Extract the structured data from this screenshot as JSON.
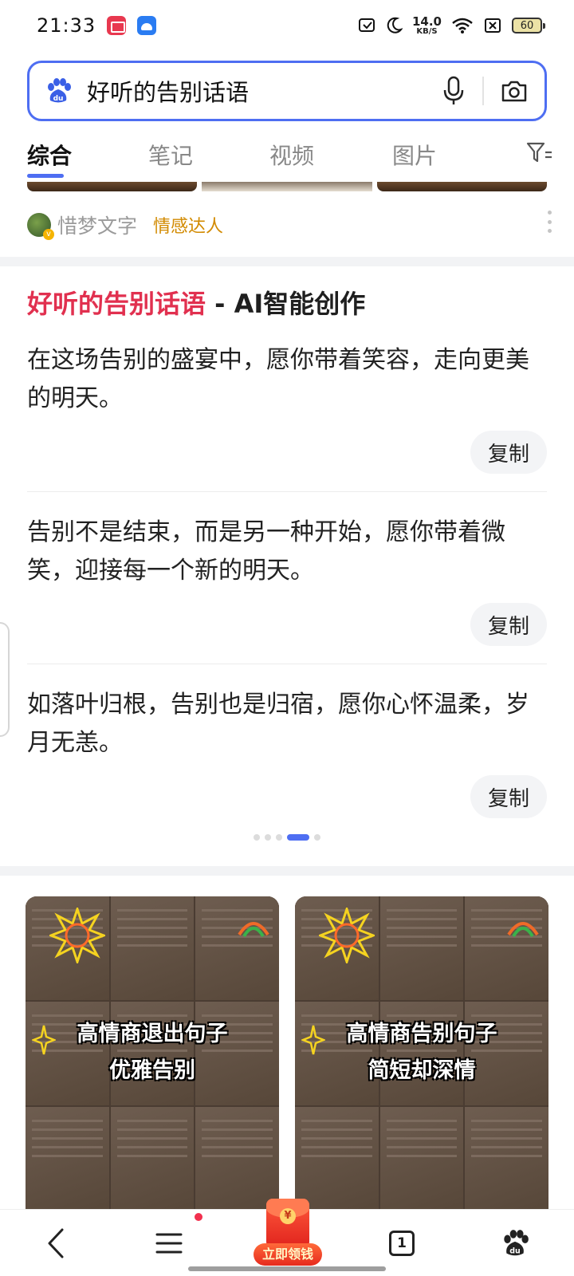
{
  "status_bar": {
    "time": "21:33",
    "app_icons": [
      "screen-record-icon",
      "android-icon"
    ],
    "net_speed_value": "14.0",
    "net_speed_unit": "KB/S",
    "battery": "60"
  },
  "search": {
    "query": "好听的告别话语"
  },
  "tabs": [
    "综合",
    "笔记",
    "视频",
    "图片"
  ],
  "active_tab": "综合",
  "prev_card": {
    "author_name": "惜梦文字",
    "author_tag": "情感达人"
  },
  "ai_card": {
    "title_highlight": "好听的告别话语",
    "title_suffix": " - AI智能创作",
    "quotes": [
      "在这场告别的盛宴中，愿你带着笑容，走向更美的明天。",
      "告别不是结束，而是另一种开始，愿你带着微笑，迎接每一个新的明天。",
      "如落叶归根，告别也是归宿，愿你心怀温柔，岁月无恙。"
    ],
    "copy_label": "复制",
    "carousel_active_index": 3,
    "carousel_count": 5
  },
  "image_results": [
    {
      "caption_line1": "高情商退出句子",
      "caption_line2": "优雅告别"
    },
    {
      "caption_line1": "高情商告别句子",
      "caption_line2": "简短却深情"
    }
  ],
  "bottom_nav": {
    "tab_count": "1",
    "redpacket_label": "立即领钱",
    "redpacket_coin": "¥"
  },
  "colors": {
    "accent": "#4e6ef2",
    "highlight": "#e1304f",
    "tag": "#d28a00"
  }
}
